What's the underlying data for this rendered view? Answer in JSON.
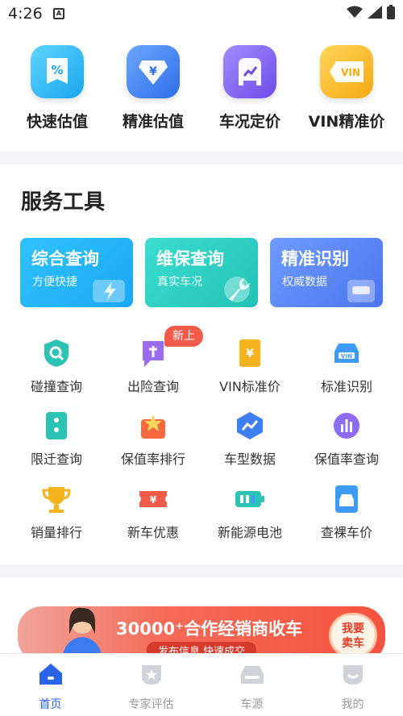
{
  "status_bar": {
    "time": "4:26",
    "notification_icon": "app-notification-icon",
    "icons": [
      "wifi-icon",
      "signal-icon",
      "battery-icon"
    ]
  },
  "quick_actions": [
    {
      "label": "快速估值",
      "icon": "percent-tag-icon",
      "color": "#1fb6f2"
    },
    {
      "label": "精准估值",
      "icon": "yuan-diamond-icon",
      "color": "#3a7ef2"
    },
    {
      "label": "车况定价",
      "icon": "car-trend-icon",
      "color": "#7b5df2"
    },
    {
      "label": "VIN精准价",
      "icon": "vin-tag-icon",
      "color": "#f7b21c"
    }
  ],
  "service_tools": {
    "title": "服务工具",
    "big_cards": [
      {
        "title": "综合查询",
        "subtitle": "方便快捷",
        "icon": "lightning-icon",
        "color": "#23b6f5"
      },
      {
        "title": "维保查询",
        "subtitle": "真实车况",
        "icon": "wrench-icon",
        "color": "#2ccfc2"
      },
      {
        "title": "精准识别",
        "subtitle": "权威数据",
        "icon": "car-scan-icon",
        "color": "#5a86f2"
      }
    ],
    "new_badge": "新上",
    "grid": [
      {
        "label": "碰撞查询",
        "icon": "collision-shield-icon"
      },
      {
        "label": "出险查询",
        "icon": "insurance-claim-icon"
      },
      {
        "label": "VIN标准价",
        "icon": "vin-price-icon"
      },
      {
        "label": "标准识别",
        "icon": "car-vin-icon"
      },
      {
        "label": "限迁查询",
        "icon": "relocation-icon"
      },
      {
        "label": "保值率排行",
        "icon": "star-ranking-icon"
      },
      {
        "label": "车型数据",
        "icon": "chart-hexagon-icon"
      },
      {
        "label": "保值率查询",
        "icon": "bar-chart-icon"
      },
      {
        "label": "销量排行",
        "icon": "trophy-icon"
      },
      {
        "label": "新车优惠",
        "icon": "coupon-icon"
      },
      {
        "label": "新能源电池",
        "icon": "battery-pack-icon"
      },
      {
        "label": "查裸车价",
        "icon": "car-price-icon"
      }
    ]
  },
  "banner": {
    "title": "30000⁺合作经销商收车",
    "subtitle": "发布信息 快速成交",
    "button": "我要卖车"
  },
  "tab_bar": [
    {
      "label": "首页",
      "icon": "home-icon",
      "active": true
    },
    {
      "label": "专家评估",
      "icon": "expert-icon",
      "active": false
    },
    {
      "label": "车源",
      "icon": "car-icon",
      "active": false
    },
    {
      "label": "我的",
      "icon": "profile-icon",
      "active": false
    }
  ],
  "colors": {
    "accent": "#2b63e8",
    "banner": "#f5533f",
    "background": "#f3f4f7"
  }
}
